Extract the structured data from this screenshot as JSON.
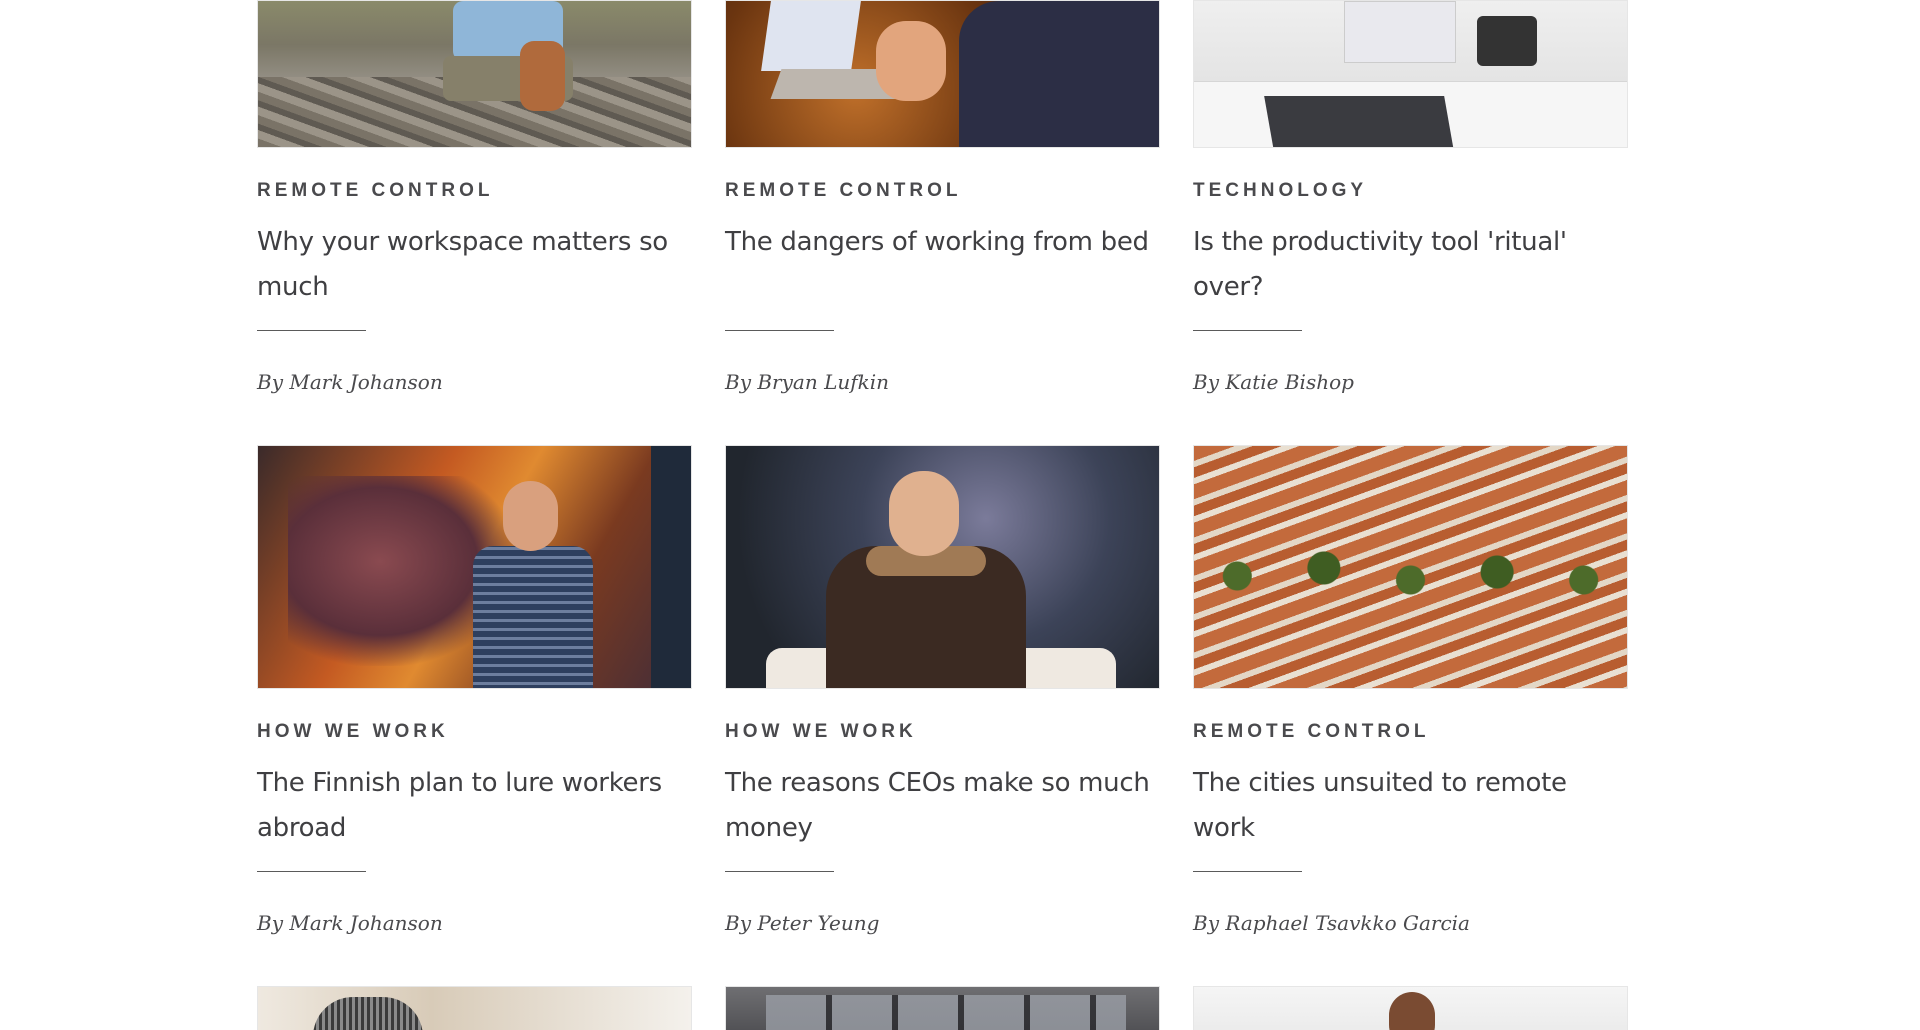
{
  "rows": [
    {
      "cards": [
        {
          "tag": "REMOTE CONTROL",
          "title": "Why your workspace matters so much",
          "byline": "By Mark Johanson",
          "image": "man-with-dog-photo"
        },
        {
          "tag": "REMOTE CONTROL",
          "title": "The dangers of working from bed",
          "byline": "By Bryan Lufkin",
          "image": "laptop-in-bed-photo"
        },
        {
          "tag": "TECHNOLOGY",
          "title": "Is the productivity tool 'ritual' over?",
          "byline": "By Katie Bishop",
          "image": "office-desk-photo"
        }
      ]
    },
    {
      "cards": [
        {
          "tag": "HOW WE WORK",
          "title": "The Finnish plan to lure workers abroad",
          "byline": "By Mark Johanson",
          "image": "man-with-dragon-art-photo"
        },
        {
          "tag": "HOW WE WORK",
          "title": "The reasons CEOs make so much money",
          "byline": "By Peter Yeung",
          "image": "ceo-with-microphone-photo"
        },
        {
          "tag": "REMOTE CONTROL",
          "title": "The cities unsuited to remote work",
          "byline": "By Raphael Tsavkko Garcia",
          "image": "aerial-housing-photo"
        }
      ]
    }
  ],
  "partial_row": [
    {
      "image": "woman-braids-photo"
    },
    {
      "image": "office-window-photo"
    },
    {
      "image": "speaker-photo"
    }
  ]
}
